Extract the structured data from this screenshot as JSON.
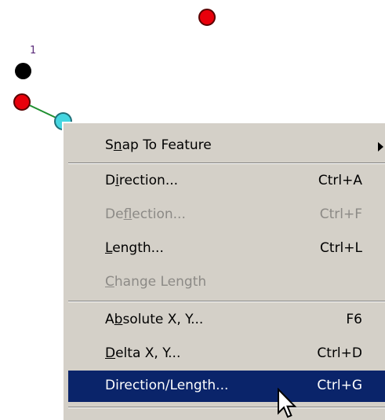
{
  "canvas": {
    "point_label": "1"
  },
  "context_menu": {
    "items": [
      {
        "label": "Snap To Feature",
        "mnemonic": "n",
        "shortcut": "",
        "has_submenu": true,
        "disabled": false
      },
      {
        "label": "Direction...",
        "mnemonic": "i",
        "shortcut": "Ctrl+A",
        "disabled": false
      },
      {
        "label": "Deflection...",
        "mnemonic": "f",
        "shortcut": "Ctrl+F",
        "disabled": true
      },
      {
        "label": "Length...",
        "mnemonic": "L",
        "shortcut": "Ctrl+L",
        "disabled": false
      },
      {
        "label": "Change Length",
        "mnemonic": "C",
        "shortcut": "",
        "disabled": true
      },
      {
        "label": "Absolute X, Y...",
        "mnemonic": "b",
        "shortcut": "F6",
        "disabled": false
      },
      {
        "label": "Delta X, Y...",
        "mnemonic": "D",
        "shortcut": "Ctrl+D",
        "disabled": false
      },
      {
        "label": "Direction/Length...",
        "mnemonic": "",
        "shortcut": "Ctrl+G",
        "disabled": false,
        "selected": true
      }
    ]
  },
  "colors": {
    "menu_background": "#d4d0c8",
    "highlight": "#0a246a",
    "disabled_text": "#8c8a86",
    "vertex_red": "#e8000b",
    "vertex_black": "#000000",
    "vertex_cyan": "#45d5e0",
    "segment_green": "#1f8f2f"
  },
  "icons": [
    "submenu-arrow-icon",
    "mouse-pointer-icon"
  ]
}
